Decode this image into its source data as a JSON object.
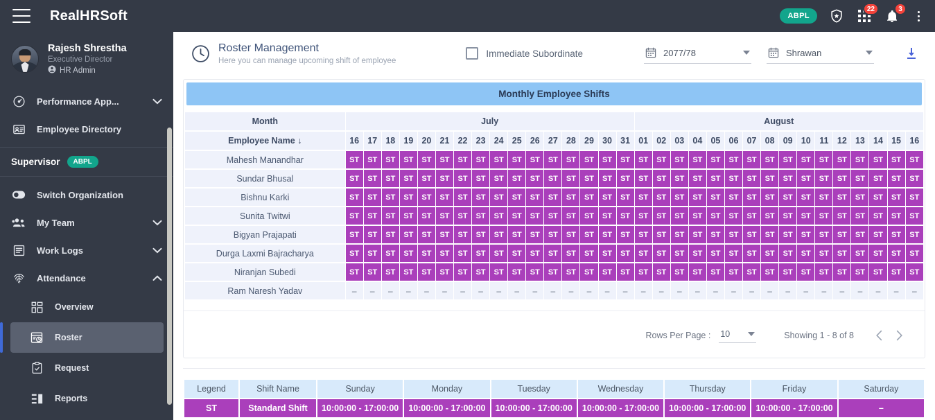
{
  "topbar": {
    "brand": "RealHRSoft",
    "org_chip": "ABPL",
    "shield_icon": "shield-star-icon",
    "apps_icon": "apps-grid-icon",
    "apps_badge": "22",
    "bell_icon": "notification-bell-icon",
    "bell_badge": "3",
    "menu_icon": "kebab-menu-icon",
    "hamburger_icon": "hamburger-menu-icon"
  },
  "sidebar": {
    "profile": {
      "name": "Rajesh Shrestha",
      "role": "Executive Director",
      "tag": "HR Admin",
      "tag_icon": "user-circle-icon",
      "avatar_icon": "user-avatar"
    },
    "items": [
      {
        "label": "Performance App...",
        "icon": "speedometer-icon",
        "chevron": "chevron-down-icon"
      },
      {
        "label": "Employee Directory",
        "icon": "id-card-icon",
        "chevron": ""
      }
    ],
    "section": {
      "label": "Supervisor",
      "pill": "ABPL"
    },
    "items2": [
      {
        "label": "Switch Organization",
        "icon": "toggle-switch-icon",
        "chevron": ""
      },
      {
        "label": "My Team",
        "icon": "people-group-icon",
        "chevron": "chevron-down-icon"
      },
      {
        "label": "Work Logs",
        "icon": "document-lines-icon",
        "chevron": "chevron-down-icon"
      },
      {
        "label": "Attendance",
        "icon": "fingerprint-icon",
        "chevron": "chevron-up-icon"
      }
    ],
    "subitems": [
      {
        "label": "Overview",
        "icon": "grid-squares-icon",
        "active": false
      },
      {
        "label": "Roster",
        "icon": "calendar-clock-icon",
        "active": true
      },
      {
        "label": "Request",
        "icon": "clipboard-check-icon",
        "active": false
      },
      {
        "label": "Reports",
        "icon": "bar-list-icon",
        "active": false
      }
    ]
  },
  "page": {
    "icon": "clock-icon",
    "title": "Roster Management",
    "subtitle": "Here you can manage upcoming shift of employee",
    "checkbox_label": "Immediate Subordinate",
    "checkbox_checked": false,
    "fiscal_year": "2077/78",
    "fiscal_year_icon": "calendar-icon",
    "month": "Shrawan",
    "month_icon": "calendar-icon",
    "download_icon": "download-icon"
  },
  "table": {
    "banner": "Monthly Employee Shifts",
    "header_month_label": "Month",
    "header_name_label": "Employee Name",
    "sort_arrow": "↓",
    "months": [
      {
        "name": "July",
        "days": [
          "16",
          "17",
          "18",
          "19",
          "20",
          "21",
          "22",
          "23",
          "24",
          "25",
          "26",
          "27",
          "28",
          "29",
          "30",
          "31"
        ]
      },
      {
        "name": "August",
        "days": [
          "01",
          "02",
          "03",
          "04",
          "05",
          "06",
          "07",
          "08",
          "09",
          "10",
          "11",
          "12",
          "13",
          "14",
          "15",
          "16"
        ]
      }
    ],
    "shift_code": "ST",
    "empty_code": "–",
    "rows": [
      {
        "name": "Mahesh Manandhar",
        "shifts": [
          "ST",
          "ST",
          "ST",
          "ST",
          "ST",
          "ST",
          "ST",
          "ST",
          "ST",
          "ST",
          "ST",
          "ST",
          "ST",
          "ST",
          "ST",
          "ST",
          "ST",
          "ST",
          "ST",
          "ST",
          "ST",
          "ST",
          "ST",
          "ST",
          "ST",
          "ST",
          "ST",
          "ST",
          "ST",
          "ST",
          "ST",
          "ST"
        ]
      },
      {
        "name": "Sundar Bhusal",
        "shifts": [
          "ST",
          "ST",
          "ST",
          "ST",
          "ST",
          "ST",
          "ST",
          "ST",
          "ST",
          "ST",
          "ST",
          "ST",
          "ST",
          "ST",
          "ST",
          "ST",
          "ST",
          "ST",
          "ST",
          "ST",
          "ST",
          "ST",
          "ST",
          "ST",
          "ST",
          "ST",
          "ST",
          "ST",
          "ST",
          "ST",
          "ST",
          "ST"
        ]
      },
      {
        "name": "Bishnu Karki",
        "shifts": [
          "ST",
          "ST",
          "ST",
          "ST",
          "ST",
          "ST",
          "ST",
          "ST",
          "ST",
          "ST",
          "ST",
          "ST",
          "ST",
          "ST",
          "ST",
          "ST",
          "ST",
          "ST",
          "ST",
          "ST",
          "ST",
          "ST",
          "ST",
          "ST",
          "ST",
          "ST",
          "ST",
          "ST",
          "ST",
          "ST",
          "ST",
          "ST"
        ]
      },
      {
        "name": "Sunita Twitwi",
        "shifts": [
          "ST",
          "ST",
          "ST",
          "ST",
          "ST",
          "ST",
          "ST",
          "ST",
          "ST",
          "ST",
          "ST",
          "ST",
          "ST",
          "ST",
          "ST",
          "ST",
          "ST",
          "ST",
          "ST",
          "ST",
          "ST",
          "ST",
          "ST",
          "ST",
          "ST",
          "ST",
          "ST",
          "ST",
          "ST",
          "ST",
          "ST",
          "ST"
        ]
      },
      {
        "name": "Bigyan Prajapati",
        "shifts": [
          "ST",
          "ST",
          "ST",
          "ST",
          "ST",
          "ST",
          "ST",
          "ST",
          "ST",
          "ST",
          "ST",
          "ST",
          "ST",
          "ST",
          "ST",
          "ST",
          "ST",
          "ST",
          "ST",
          "ST",
          "ST",
          "ST",
          "ST",
          "ST",
          "ST",
          "ST",
          "ST",
          "ST",
          "ST",
          "ST",
          "ST",
          "ST"
        ]
      },
      {
        "name": "Durga Laxmi Bajracharya",
        "shifts": [
          "ST",
          "ST",
          "ST",
          "ST",
          "ST",
          "ST",
          "ST",
          "ST",
          "ST",
          "ST",
          "ST",
          "ST",
          "ST",
          "ST",
          "ST",
          "ST",
          "ST",
          "ST",
          "ST",
          "ST",
          "ST",
          "ST",
          "ST",
          "ST",
          "ST",
          "ST",
          "ST",
          "ST",
          "ST",
          "ST",
          "ST",
          "ST"
        ]
      },
      {
        "name": "Niranjan Subedi",
        "shifts": [
          "ST",
          "ST",
          "ST",
          "ST",
          "ST",
          "ST",
          "ST",
          "ST",
          "ST",
          "ST",
          "ST",
          "ST",
          "ST",
          "ST",
          "ST",
          "ST",
          "ST",
          "ST",
          "ST",
          "ST",
          "ST",
          "ST",
          "ST",
          "ST",
          "ST",
          "ST",
          "ST",
          "ST",
          "ST",
          "ST",
          "ST",
          "ST"
        ]
      },
      {
        "name": "Ram Naresh Yadav",
        "shifts": [
          "-",
          "-",
          "-",
          "-",
          "-",
          "-",
          "-",
          "-",
          "-",
          "-",
          "-",
          "-",
          "-",
          "-",
          "-",
          "-",
          "-",
          "-",
          "-",
          "-",
          "-",
          "-",
          "-",
          "-",
          "-",
          "-",
          "-",
          "-",
          "-",
          "-",
          "-",
          "-"
        ]
      }
    ]
  },
  "pager": {
    "rows_per_page_label": "Rows Per Page :",
    "rows_per_page_value": "10",
    "showing": "Showing 1 - 8 of 8",
    "prev_icon": "chevron-left-icon",
    "next_icon": "chevron-right-icon"
  },
  "legend": {
    "headers": [
      "Legend",
      "Shift Name",
      "Sunday",
      "Monday",
      "Tuesday",
      "Wednesday",
      "Thursday",
      "Friday",
      "Saturday"
    ],
    "row": [
      "ST",
      "Standard Shift",
      "10:00:00 - 17:00:00",
      "10:00:00 - 17:00:00",
      "10:00:00 - 17:00:00",
      "10:00:00 - 17:00:00",
      "10:00:00 - 17:00:00",
      "10:00:00 - 17:00:00",
      "–"
    ]
  },
  "colors": {
    "sidebar_bg": "#343a46",
    "accent_purple": "#aa3fbb",
    "banner_blue": "#8ec5f5",
    "legend_head_blue": "#d8eafb",
    "badge_red": "#f4433b",
    "org_teal": "#12a58c",
    "download_blue": "#4a63d8",
    "active_blue": "#3f6ad8"
  }
}
